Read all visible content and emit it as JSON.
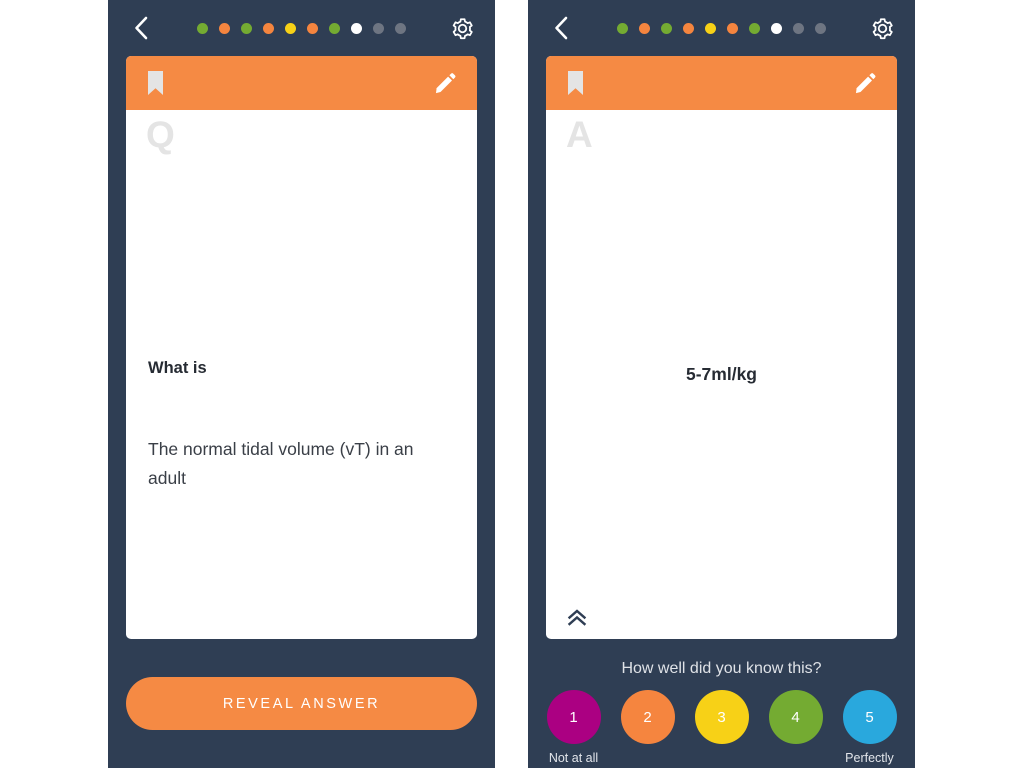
{
  "app": {
    "background": "#ffffff",
    "panel_bg": "#2f3e54",
    "accent": "#f58a44",
    "card_bg": "#ffffff"
  },
  "panels": [
    {
      "id": "question-panel",
      "topbar": {
        "back_icon": "chevron-left-icon",
        "settings_icon": "gear-icon",
        "progress_dots": [
          {
            "color": "#74ab32",
            "state": "correct"
          },
          {
            "color": "#f5853f",
            "state": "partial"
          },
          {
            "color": "#74ab32",
            "state": "correct"
          },
          {
            "color": "#f5853f",
            "state": "partial"
          },
          {
            "color": "#f7d117",
            "state": "medium"
          },
          {
            "color": "#f5853f",
            "state": "partial"
          },
          {
            "color": "#74ab32",
            "state": "correct"
          },
          {
            "color": "#ffffff",
            "state": "current"
          },
          {
            "color": "#6e7582",
            "state": "upcoming"
          },
          {
            "color": "#6e7582",
            "state": "upcoming"
          }
        ]
      },
      "card": {
        "header": {
          "bookmark_icon": "bookmark-icon",
          "edit_icon": "pencil-icon"
        },
        "watermark": "Q",
        "prompt": "What is",
        "text": "The normal tidal volume (vT) in an adult"
      },
      "action": {
        "reveal_label": "REVEAL ANSWER"
      }
    },
    {
      "id": "answer-panel",
      "topbar": {
        "back_icon": "chevron-left-icon",
        "settings_icon": "gear-icon",
        "progress_dots": [
          {
            "color": "#74ab32",
            "state": "correct"
          },
          {
            "color": "#f5853f",
            "state": "partial"
          },
          {
            "color": "#74ab32",
            "state": "correct"
          },
          {
            "color": "#f5853f",
            "state": "partial"
          },
          {
            "color": "#f7d117",
            "state": "medium"
          },
          {
            "color": "#f5853f",
            "state": "partial"
          },
          {
            "color": "#74ab32",
            "state": "correct"
          },
          {
            "color": "#ffffff",
            "state": "current"
          },
          {
            "color": "#6e7582",
            "state": "upcoming"
          },
          {
            "color": "#6e7582",
            "state": "upcoming"
          }
        ]
      },
      "card": {
        "header": {
          "bookmark_icon": "bookmark-icon",
          "edit_icon": "pencil-icon"
        },
        "watermark": "A",
        "text": "5-7ml/kg",
        "collapse_icon": "double-chevron-up-icon"
      },
      "rating": {
        "question": "How well did you know this?",
        "left_caption": "Not at all",
        "right_caption": "Perfectly",
        "options": [
          {
            "value": "1",
            "color": "#ab0082"
          },
          {
            "value": "2",
            "color": "#f5853f"
          },
          {
            "value": "3",
            "color": "#f7d117"
          },
          {
            "value": "4",
            "color": "#74ab32"
          },
          {
            "value": "5",
            "color": "#29a8dd"
          }
        ]
      }
    }
  ]
}
